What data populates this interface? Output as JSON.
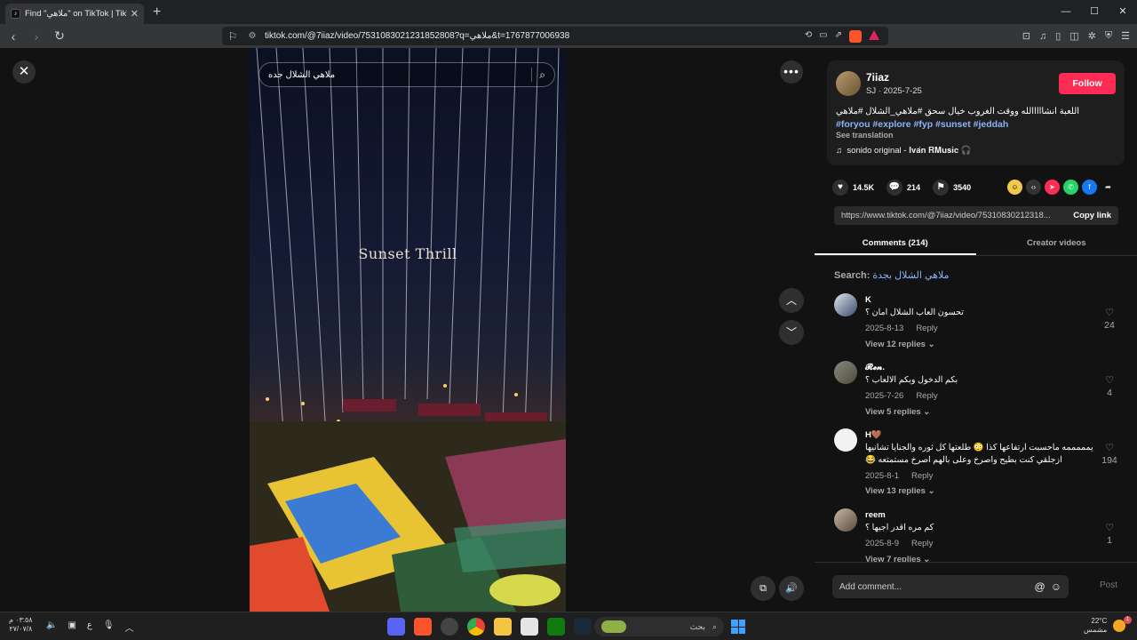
{
  "browser": {
    "tab_title": "Find \"ملاهي\" on TikTok | TikTok",
    "new_tab": "+",
    "url": "tiktok.com/@7iiaz/video/7531083021231852808?q=ملاهي&t=1767877006938",
    "window_controls": [
      "—",
      "☐",
      "✕"
    ]
  },
  "search": {
    "query": "ملاهي الشلال جده"
  },
  "video": {
    "caption": "Sunset Thrill"
  },
  "post": {
    "username": "7iiaz",
    "sub": "SJ · 2025-7-25",
    "follow_label": "Follow",
    "description": "اللعبة انشااااالله ووقت الغروب خيال سحق #ملاهي_الشلال #ملاهي",
    "tags": "#foryou #explore #fyp #sunset #jeddah",
    "see_translation": "See translation",
    "music": "sonido original - 𝐈𝐯𝐚́𝐧 𝐑𝐌𝐮𝐬𝐢𝐜 🎧",
    "likes": "14.5K",
    "comments": "214",
    "saves": "3540",
    "link": "https://www.tiktok.com/@7iiaz/video/75310830212318...",
    "copy_link": "Copy link"
  },
  "tabs": {
    "comments": "Comments (214)",
    "creator": "Creator videos"
  },
  "search_line": {
    "label": "Search: ",
    "query": "ملاهي الشلال بجدة"
  },
  "comments": [
    {
      "name": "K",
      "text": "تحسون العاب الشلال امان ؟",
      "date": "2025-8-13",
      "reply": "Reply",
      "replies": "View 12 replies ⌄",
      "likes": "24"
    },
    {
      "name": "𝓡𝓮𝓷.",
      "text": "بكم الدخول وبكم الالعاب ؟",
      "date": "2025-7-26",
      "reply": "Reply",
      "replies": "View 5 replies ⌄",
      "likes": "4"
    },
    {
      "name": "H🤎",
      "text": "يمممممه ماحسبت ارتفاعها كذا 😳 طلعتها كل ثوره والجنايا تشانيها ازجلقي كنت بطيح واصرخ وعلى بالهم اصرخ مستمتعه 😂",
      "date": "2025-8-1",
      "reply": "Reply",
      "replies": "View 13 replies ⌄",
      "likes": "194"
    },
    {
      "name": "reem",
      "text": "كم مره اقدر اجيها ؟",
      "date": "2025-8-9",
      "reply": "Reply",
      "replies": "View 7 replies ⌄",
      "likes": "1"
    }
  ],
  "add_comment": {
    "placeholder": "Add comment...",
    "post": "Post"
  },
  "taskbar": {
    "time": "٠٣:٥٨ م",
    "date": "٢٧/٠٧/٨",
    "search": "بحث",
    "temp": "22°C",
    "weather": "مشمس",
    "badge": "1"
  }
}
